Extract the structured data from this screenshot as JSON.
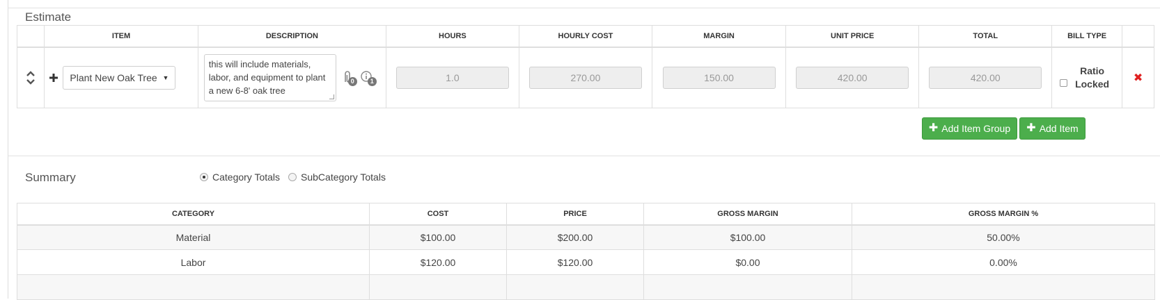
{
  "estimate": {
    "title": "Estimate",
    "columns": [
      "ITEM",
      "DESCRIPTION",
      "HOURS",
      "HOURLY COST",
      "MARGIN",
      "UNIT PRICE",
      "TOTAL",
      "BILL TYPE"
    ],
    "row": {
      "item": "Plant New Oak Tree",
      "description": "this will include materials, labor, and equipment to plant a new 6-8' oak tree",
      "attachment_count": "0",
      "info_count": "1",
      "hours": "1.0",
      "hourly_cost": "270.00",
      "margin": "150.00",
      "unit_price": "420.00",
      "total": "420.00",
      "bill_type_label": "Ratio Locked"
    },
    "add_group_label": "Add Item Group",
    "add_item_label": "Add Item"
  },
  "summary": {
    "title": "Summary",
    "radio_options": [
      "Category Totals",
      "SubCategory Totals"
    ],
    "selected": "Category Totals",
    "columns": [
      "CATEGORY",
      "COST",
      "PRICE",
      "GROSS MARGIN",
      "GROSS MARGIN %"
    ],
    "rows": [
      {
        "category": "Material",
        "cost": "$100.00",
        "price": "$200.00",
        "gross_margin": "$100.00",
        "gross_margin_pct": "50.00%"
      },
      {
        "category": "Labor",
        "cost": "$120.00",
        "price": "$120.00",
        "gross_margin": "$0.00",
        "gross_margin_pct": "0.00%"
      }
    ]
  },
  "colors": {
    "accent_green": "#4cae4c",
    "remove_red": "#e02020"
  },
  "icons": {
    "move": "sort-arrows-icon",
    "add": "plus-icon",
    "attachment": "paperclip-icon",
    "info": "info-icon",
    "remove": "close-icon"
  }
}
